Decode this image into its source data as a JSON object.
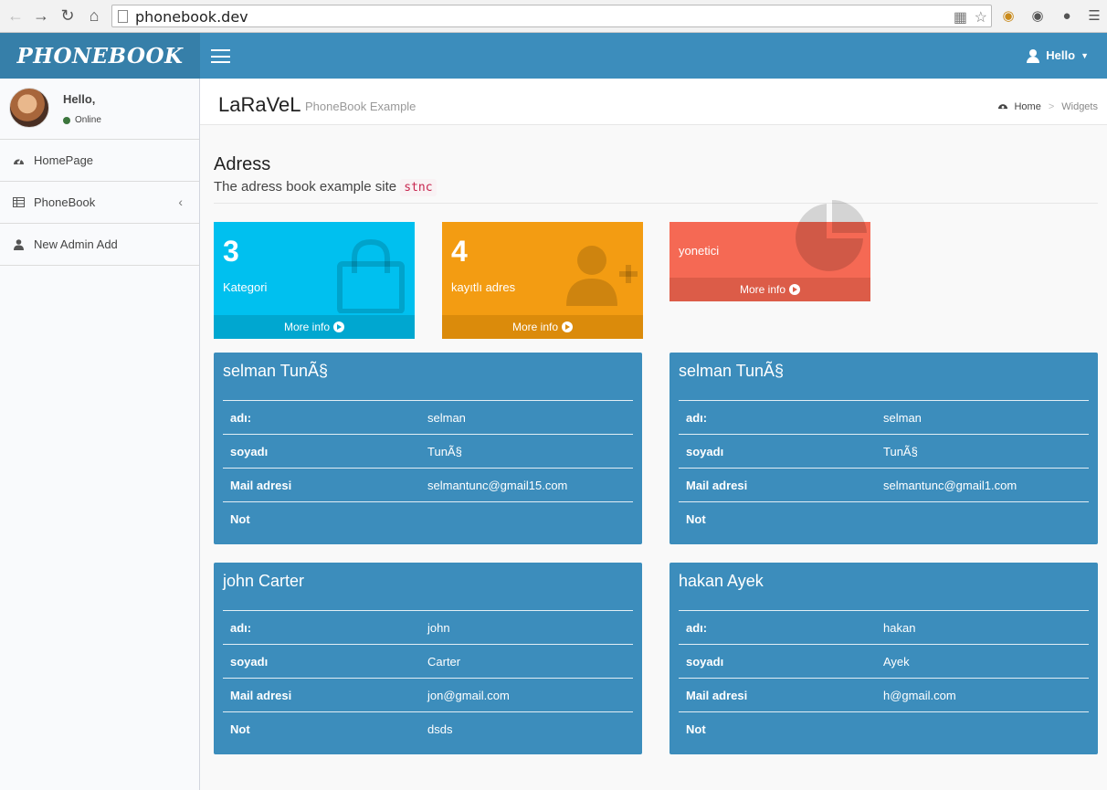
{
  "browser": {
    "url": "phonebook.dev"
  },
  "app": {
    "logo": "PHONEBOOK",
    "user_menu": "Hello"
  },
  "sidebar": {
    "user": {
      "greeting": "Hello,",
      "status": "Online"
    },
    "items": [
      {
        "label": "HomePage",
        "icon": "dashboard-icon"
      },
      {
        "label": "PhoneBook",
        "icon": "table-icon"
      },
      {
        "label": "New Admin Add",
        "icon": "user-icon"
      }
    ]
  },
  "header": {
    "title": "LaRaVeL",
    "subtitle": "PhoneBook Example",
    "breadcrumb": {
      "home": "Home",
      "sep": ">",
      "current": "Widgets"
    }
  },
  "page": {
    "title": "Adress",
    "subtitle": "The adress book example site",
    "code": "stnc"
  },
  "stats": [
    {
      "value": "3",
      "label": "Kategori",
      "footer": "More info",
      "icon": "shopping-bag-icon",
      "color": "#00c0ef"
    },
    {
      "value": "4",
      "label": "kayıtlı adres",
      "footer": "More info",
      "icon": "user-plus-icon",
      "color": "#f39c12"
    },
    {
      "value": "",
      "label": "yonetici",
      "footer": "More info",
      "icon": "pie-chart-icon",
      "color": "#f56954"
    }
  ],
  "field_labels": {
    "name": "adı:",
    "surname": "soyadı",
    "mail": "Mail adresi",
    "note": "Not"
  },
  "contacts": [
    {
      "title": "selman TunÃ§",
      "name": "selman",
      "surname": "TunÃ§",
      "mail": "selmantunc@gmail15.com",
      "note": ""
    },
    {
      "title": "selman TunÃ§",
      "name": "selman",
      "surname": "TunÃ§",
      "mail": "selmantunc@gmail1.com",
      "note": ""
    },
    {
      "title": "john Carter",
      "name": "john",
      "surname": "Carter",
      "mail": "jon@gmail.com",
      "note": "dsds"
    },
    {
      "title": "hakan Ayek",
      "name": "hakan",
      "surname": "Ayek",
      "mail": "h@gmail.com",
      "note": ""
    }
  ]
}
